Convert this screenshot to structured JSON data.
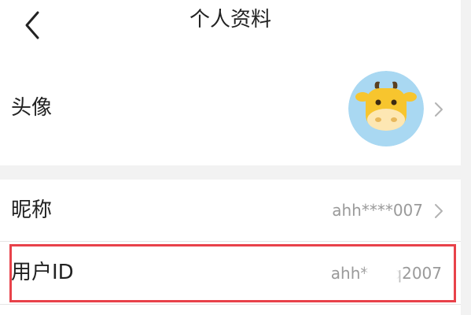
{
  "header": {
    "title": "个人资料",
    "back_icon": "chevron-left-icon"
  },
  "rows": {
    "avatar": {
      "label": "头像",
      "icon": "cow-avatar-icon",
      "chevron_icon": "chevron-right-icon"
    },
    "nickname": {
      "label": "昵称",
      "value": "ahh****007",
      "chevron_icon": "chevron-right-icon"
    },
    "user_id": {
      "label": "用户ID",
      "value": "ahh****q2007"
    }
  },
  "colors": {
    "page_background": "#f2f2f2",
    "panel_background": "#ffffff",
    "text_primary": "#222222",
    "text_secondary": "#9a9a9a",
    "highlight_border": "#e8424a",
    "avatar_background": "#a9d8f2",
    "avatar_face": "#f7c52e",
    "avatar_snout": "#fde7b3"
  }
}
